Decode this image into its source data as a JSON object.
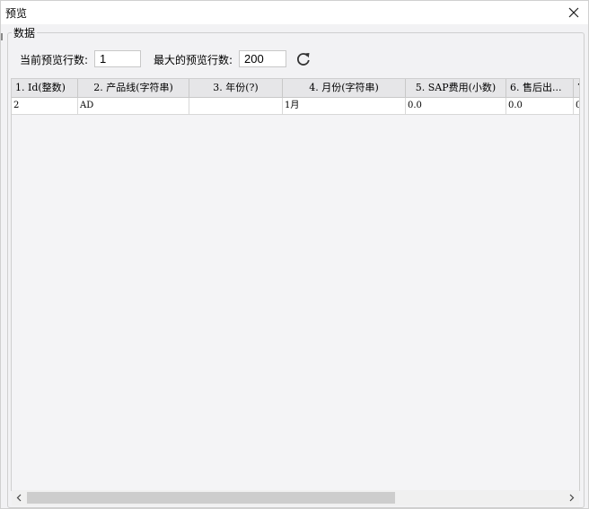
{
  "window": {
    "title": "预览"
  },
  "group": {
    "legend": "数据"
  },
  "params": {
    "current_rows_label": "当前预览行数:",
    "current_rows_value": "1",
    "max_rows_label": "最大的预览行数:",
    "max_rows_value": "200"
  },
  "icons": {
    "close": "close-icon",
    "refresh": "refresh-icon",
    "scroll_left": "chevron-left-icon",
    "scroll_right": "chevron-right-icon"
  },
  "table": {
    "columns": [
      "1. Id(整数)",
      "2. 产品线(字符串)",
      "3. 年份(?)",
      "4. 月份(字符串)",
      "5. SAP费用(小数)",
      "6. 售后出...",
      "7."
    ],
    "rows": [
      [
        "2",
        "AD",
        "",
        "1月",
        "0.0",
        "0.0",
        "0."
      ]
    ]
  },
  "colors": {
    "background": "#f2f2f4",
    "header": "#e6e6e8",
    "scroll_thumb": "#cdcdcd"
  }
}
